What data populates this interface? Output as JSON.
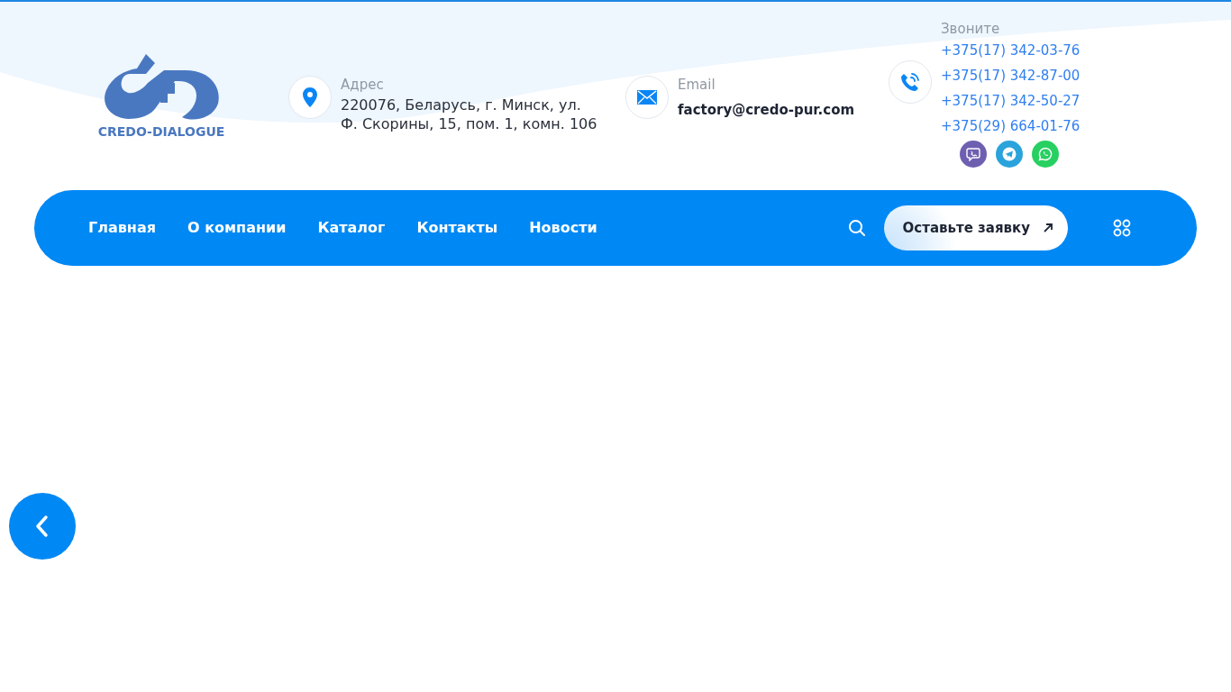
{
  "logo": {
    "text": "CREDO-DIALOGUE"
  },
  "contacts": [
    {
      "kind": "address",
      "label": "Адрес",
      "lines": [
        "220076, Беларусь, г. Минск, ул.",
        "Ф. Скорины, 15, пом. 1, комн. 106"
      ]
    },
    {
      "kind": "email",
      "label": "Email",
      "lines": [
        "factory@credo-pur.com"
      ]
    },
    {
      "kind": "phone",
      "label": "Звоните",
      "lines": [
        "+375(17) 342-03-76",
        "+375(17) 342-87-00",
        "+375(17) 342-50-27",
        "+375(29) 664-01-76"
      ]
    }
  ],
  "messengers": [
    {
      "kind": "viber",
      "color": "#6f5fb0"
    },
    {
      "kind": "telegram",
      "color": "#2aa3dc"
    },
    {
      "kind": "whatsapp",
      "color": "#27d061"
    }
  ],
  "nav": {
    "items": [
      "Главная",
      "О компании",
      "Каталог",
      "Контакты",
      "Новости"
    ],
    "cta": "Оставьте заявку"
  }
}
